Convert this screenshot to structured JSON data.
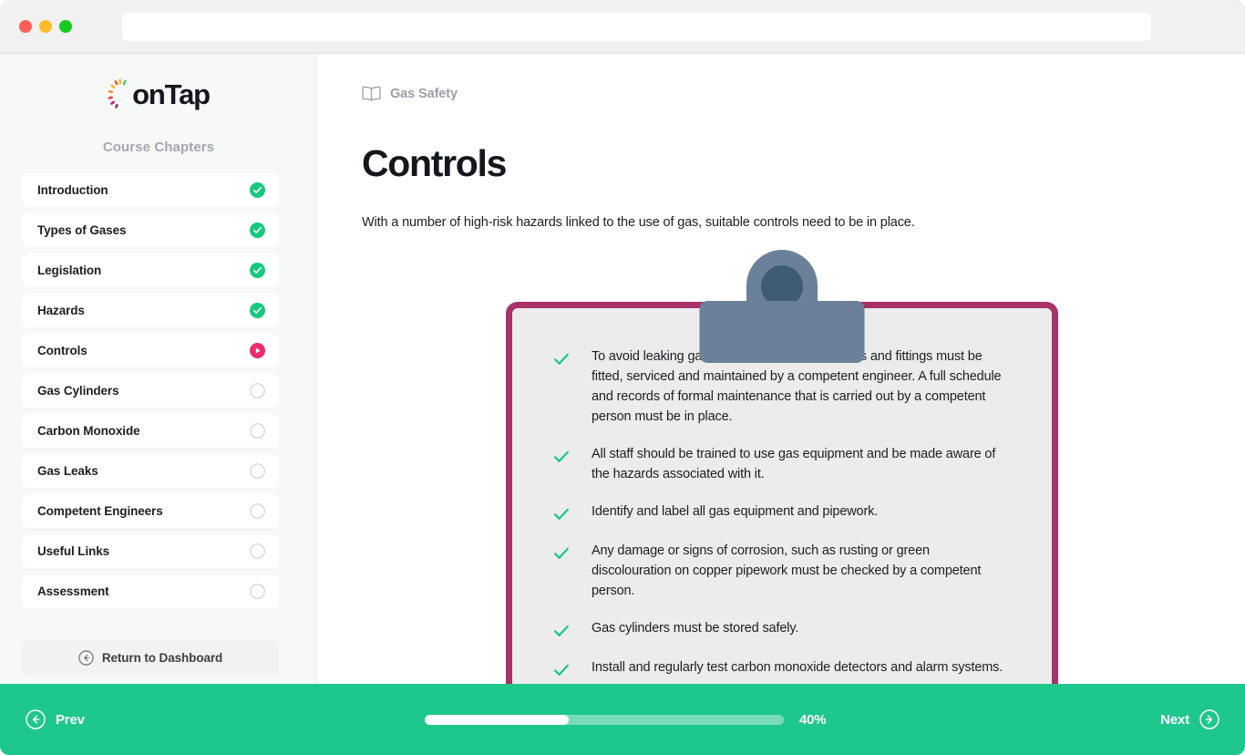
{
  "browser": {
    "url_value": "",
    "url_placeholder": "",
    "traffic_lights": [
      "close-red",
      "minimize-yellow",
      "maximize-green"
    ]
  },
  "sidebar": {
    "logo_text": "onTap",
    "heading": "Course Chapters",
    "items": [
      {
        "label": "Introduction",
        "status": "complete"
      },
      {
        "label": "Types of Gases",
        "status": "complete"
      },
      {
        "label": "Legislation",
        "status": "complete"
      },
      {
        "label": "Hazards",
        "status": "complete"
      },
      {
        "label": "Controls",
        "status": "current"
      },
      {
        "label": "Gas Cylinders",
        "status": "locked"
      },
      {
        "label": "Carbon Monoxide",
        "status": "locked"
      },
      {
        "label": "Gas Leaks",
        "status": "locked"
      },
      {
        "label": "Competent Engineers",
        "status": "locked"
      },
      {
        "label": "Useful Links",
        "status": "locked"
      },
      {
        "label": "Assessment",
        "status": "locked"
      }
    ],
    "return_dashboard_label": "Return to Dashboard"
  },
  "main": {
    "breadcrumb": "Gas Safety",
    "title": "Controls",
    "intro": "With a number of high-risk hazards linked to the use of gas, suitable controls need to be in place.",
    "checklist": [
      "To avoid leaking gas, all gas appliances, fixtures and fittings must be fitted, serviced and maintained by a competent engineer. A full schedule and records of formal maintenance that is carried out by a competent person must be in place.",
      "All staff should be trained to use gas equipment and be made aware of the hazards associated with it.",
      "Identify and label all gas equipment and pipework.",
      "Any damage or signs of corrosion, such as rusting or green discolouration on copper pipework must be checked by a competent person.",
      "Gas cylinders must be stored safely.",
      "Install and regularly test carbon monoxide detectors and alarm systems."
    ]
  },
  "bottom_nav": {
    "prev_label": "Prev",
    "next_label": "Next",
    "progress_percent": 40,
    "progress_label": "40%"
  },
  "colors": {
    "accent_green": "#1ec78c",
    "check_green": "#16c97f",
    "current_pink": "#f02a6e",
    "clipboard_border": "#a8326a",
    "clip_slate": "#6b8199",
    "clip_slate_dark": "#3f5c75",
    "sidebar_bg": "#f7f8f8"
  }
}
